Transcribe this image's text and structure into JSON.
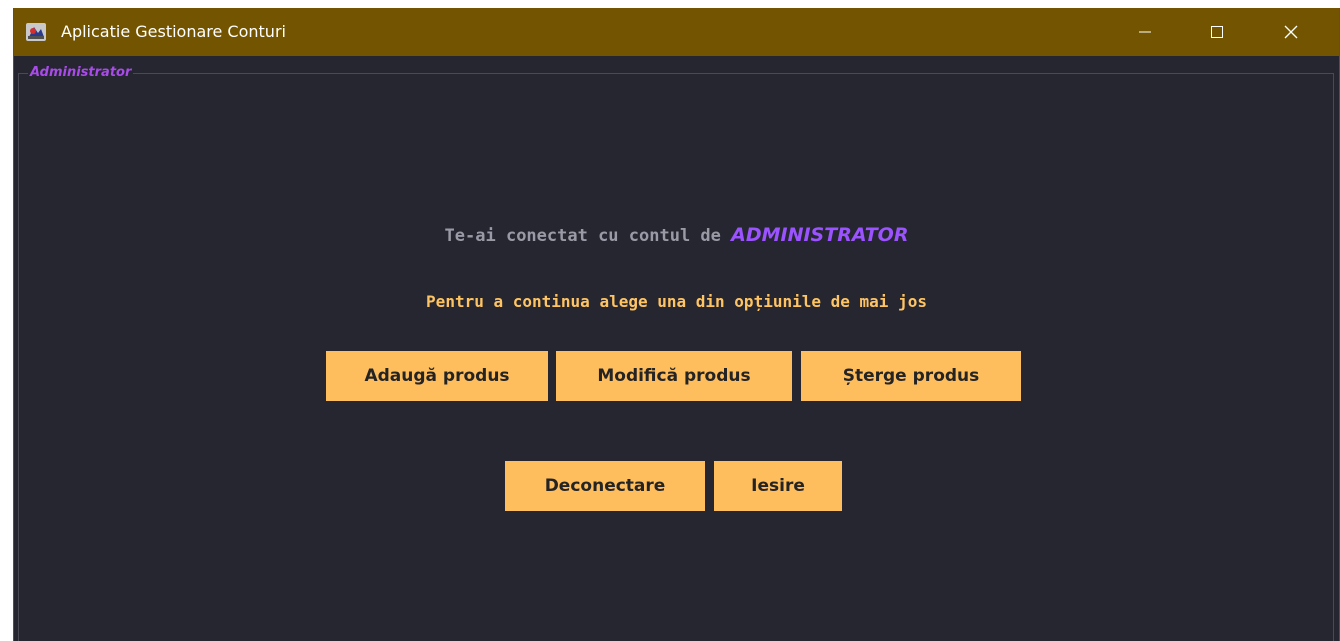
{
  "window": {
    "title": "Aplicatie Gestionare Conturi",
    "icon": "app-icon",
    "controls": {
      "minimize": "minimize-icon",
      "maximize": "maximize-icon",
      "close": "close-icon"
    }
  },
  "panel": {
    "title": "Administrator"
  },
  "message": {
    "prefix": "Te-ai conectat cu contul de ",
    "role": "ADMINISTRATOR",
    "instruction": "Pentru a continua alege una din opțiunile de mai jos"
  },
  "actions": {
    "add_product": "Adaugă produs",
    "modify_product": "Modifică produs",
    "delete_product": "Șterge produs",
    "logout": "Deconectare",
    "exit": "Iesire"
  },
  "colors": {
    "titlebar": "#735400",
    "background": "#262631",
    "accent_purple": "#9b52ff",
    "button": "#ffbe5e",
    "instruction_text": "#ffc462"
  }
}
